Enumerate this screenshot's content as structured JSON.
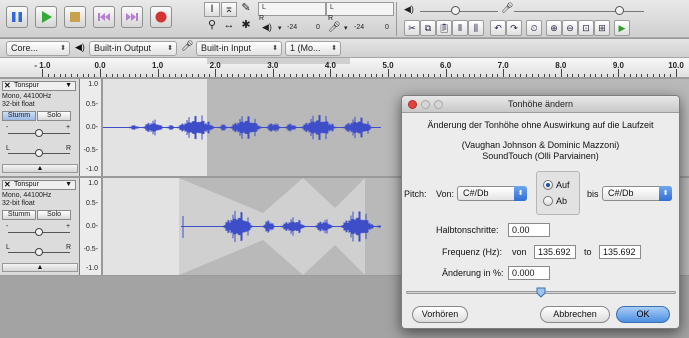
{
  "toolbar": {
    "transport": [
      "pause",
      "play",
      "stop",
      "skip-start",
      "skip-end",
      "record"
    ],
    "meter": {
      "playback_labels": [
        "L",
        "R"
      ],
      "record_labels": [
        "L",
        "R"
      ],
      "scale_play": "-24",
      "scale_play_zero": "0",
      "scale_rec": "-24",
      "scale_rec_zero": "0"
    }
  },
  "devices": {
    "host": "Core...",
    "output": "Built-in Output",
    "input": "Built-in Input",
    "channels": "1 (Mo..."
  },
  "ruler": {
    "labels": [
      "- 1.0",
      "0.0",
      "1.0",
      "2.0",
      "3.0",
      "4.0",
      "5.0",
      "6.0",
      "7.0",
      "8.0",
      "9.0",
      "10.0"
    ]
  },
  "tracks": [
    {
      "name": "Tonspur",
      "info_line1": "Mono, 44100Hz",
      "info_line2": "32-bit float",
      "mute_label": "Stumm",
      "solo_label": "Solo",
      "gain_minus": "-",
      "gain_plus": "+",
      "pan_left": "L",
      "pan_right": "R",
      "scale": [
        "1.0",
        "0.5-",
        "0.0-",
        "-0.5-",
        "-1.0"
      ]
    },
    {
      "name": "Tonspur",
      "info_line1": "Mono, 44100Hz",
      "info_line2": "32-bit float",
      "mute_label": "Stumm",
      "solo_label": "Solo",
      "gain_minus": "-",
      "gain_plus": "+",
      "pan_left": "L",
      "pan_right": "R",
      "scale": [
        "1.0",
        "0.5-",
        "0.0-",
        "-0.5-",
        "-1.0"
      ]
    }
  ],
  "dialog": {
    "title": "Tonhöhe ändern",
    "description": "Änderung der Tonhöhe ohne Auswirkung auf die Laufzeit",
    "credit_line1": "(Vaughan Johnson & Dominic Mazzoni)",
    "credit_line2": "SoundTouch (Olli Parviainen)",
    "pitch_label": "Pitch:",
    "from_label": "Von:",
    "from_value": "C#/Db",
    "direction_up": "Auf",
    "direction_down": "Ab",
    "direction_selected": "Auf",
    "to_label": "bis",
    "to_value": "C#/Db",
    "semitones_label": "Halbtonschritte:",
    "semitones_value": "0.00",
    "freq_label": "Frequenz (Hz):",
    "freq_from_label": "von",
    "freq_from_value": "135.692",
    "freq_to_label": "to",
    "freq_to_value": "135.692",
    "percent_label": "Änderung in %:",
    "percent_value": "0.000",
    "slider_fraction": 0.5,
    "preview_button": "Vorhören",
    "cancel_button": "Abbrechen",
    "ok_button": "OK"
  },
  "colors": {
    "waveform": "#3e4ec8",
    "selection": "#b9b9b9",
    "record": "#d23434",
    "play": "#35a935",
    "pause": "#2f6ad8"
  }
}
